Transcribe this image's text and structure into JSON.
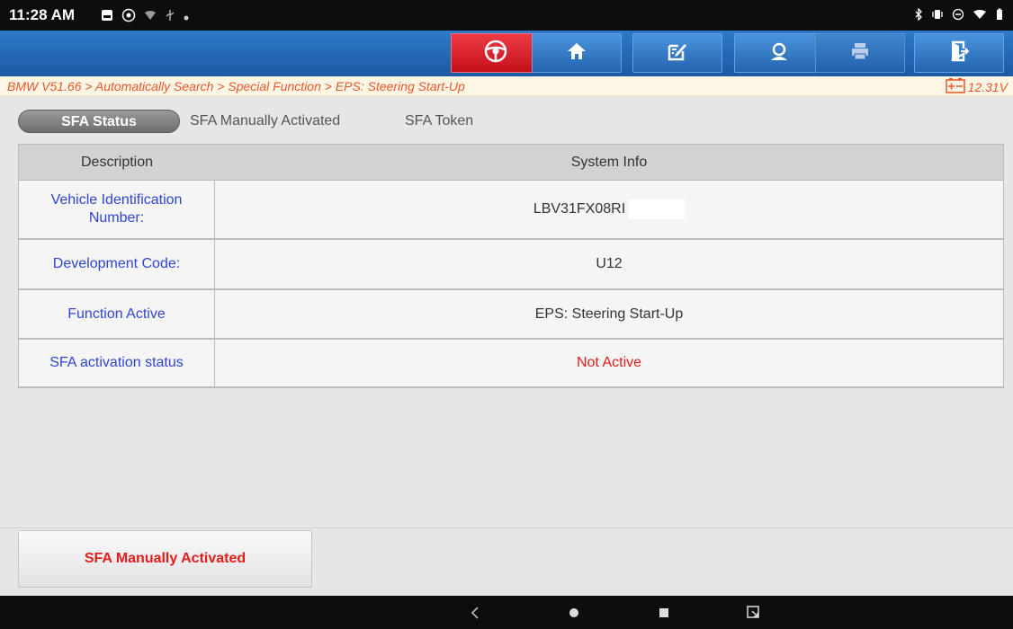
{
  "status_bar": {
    "time": "11:28 AM",
    "left_icons": [
      "gallery-icon",
      "camera-icon",
      "wifi-icon",
      "usb-icon",
      "dot-icon"
    ],
    "right_icons": [
      "bluetooth-icon",
      "vibrate-icon",
      "dnd-icon",
      "wifi-icon",
      "battery-icon"
    ]
  },
  "toolbar": {
    "buttons": [
      {
        "name": "diagnose-button",
        "icon": "steering-wheel-icon",
        "color": "#e31b1b"
      },
      {
        "name": "home-button",
        "icon": "home-icon"
      },
      {
        "name": "edit-report-button",
        "icon": "edit-icon"
      },
      {
        "name": "remote-support-button",
        "icon": "support-icon"
      },
      {
        "name": "print-button",
        "icon": "print-icon"
      },
      {
        "name": "exit-button",
        "icon": "exit-icon"
      }
    ]
  },
  "breadcrumb": {
    "text": "BMW V51.66 > Automatically Search > Special Function > EPS: Steering Start-Up",
    "voltage": "12.31V",
    "color": "#e8562c"
  },
  "tabs": [
    {
      "label": "SFA Status",
      "active": true
    },
    {
      "label": "SFA Manually Activated",
      "active": false
    },
    {
      "label": "SFA Token",
      "active": false
    }
  ],
  "table": {
    "headers": [
      "Description",
      "System Info"
    ],
    "rows": [
      {
        "key": "Vehicle Identification Number:",
        "value": "LBV31FX08RI"
      },
      {
        "key": "Development Code:",
        "value": "U12"
      },
      {
        "key": "Function Active",
        "value": "EPS: Steering Start-Up"
      },
      {
        "key": "SFA activation status",
        "value": "Not Active",
        "value_color": "#e31b1b"
      }
    ]
  },
  "action_button": {
    "label": "SFA Manually Activated"
  },
  "nav_bar": [
    "back-icon",
    "home-circle-icon",
    "recents-icon",
    "screenshot-icon"
  ]
}
